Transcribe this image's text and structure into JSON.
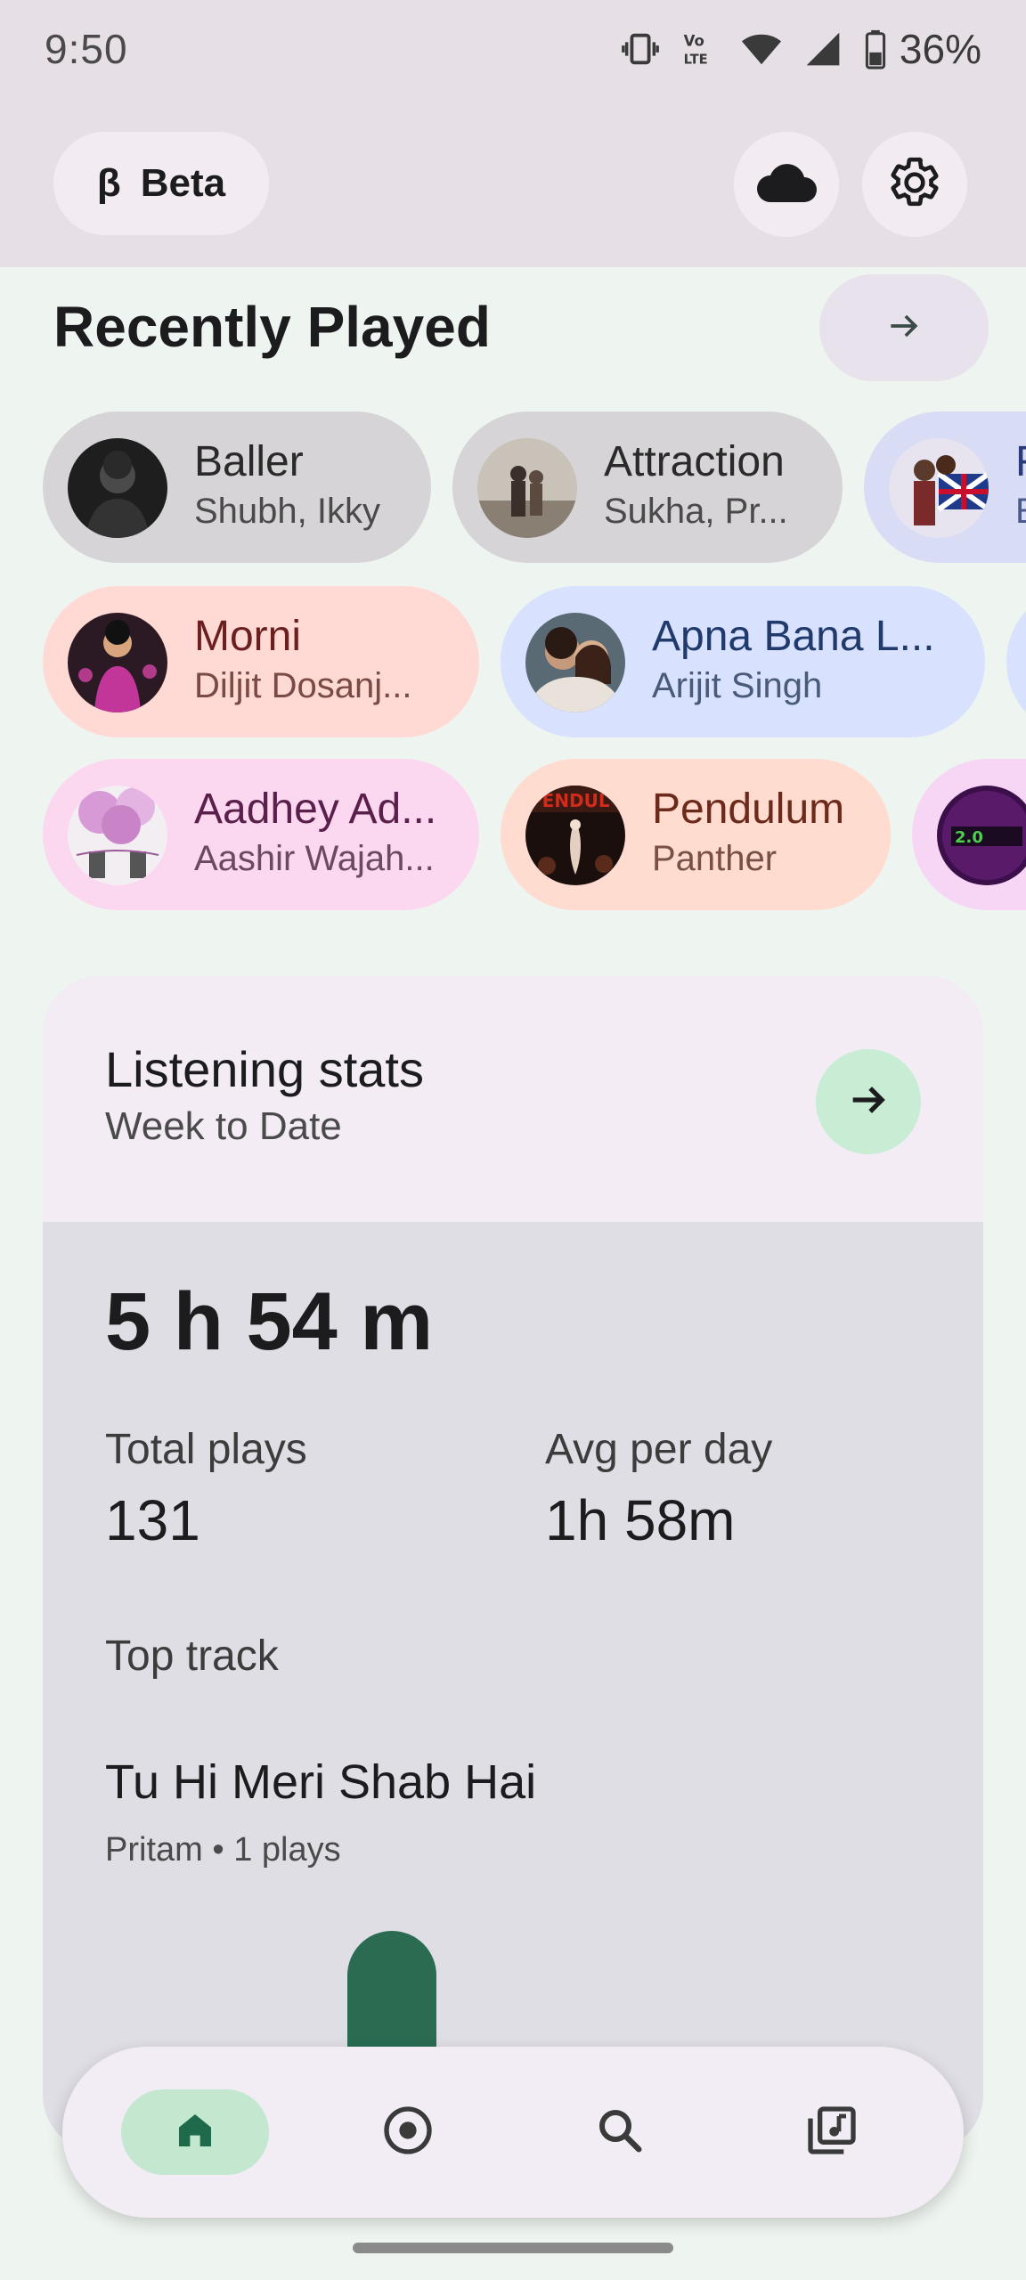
{
  "status_bar": {
    "time": "9:50",
    "battery_percent": "36%",
    "icons": [
      "vibrate-icon",
      "volte-icon",
      "wifi-icon",
      "signal-icon",
      "battery-icon"
    ]
  },
  "app_bar": {
    "beta_symbol": "β",
    "beta_label": "Beta",
    "cloud_icon": "cloud-icon",
    "settings_icon": "gear-icon"
  },
  "recently_played": {
    "title": "Recently Played",
    "rows": [
      [
        {
          "song": "Baller",
          "artist": "Shubh, Ikky",
          "bg": "#d6d4d6",
          "text_color": "#2a2a2a",
          "sub_color": "#4a4a4a"
        },
        {
          "song": "Attraction",
          "artist": "Sukha, Pr...",
          "bg": "#d6d4d6",
          "text_color": "#2a2a2a",
          "sub_color": "#4a4a4a"
        },
        {
          "song": "F",
          "artist": "E",
          "bg": "#d9dcf5",
          "text_color": "#2b3b7a",
          "sub_color": "#4a5a8a"
        }
      ],
      [
        {
          "song": "Morni",
          "artist": "Diljit Dosanj...",
          "bg": "#ffdad5",
          "text_color": "#6b1f1f",
          "sub_color": "#7a4a44"
        },
        {
          "song": "Apna Bana L...",
          "artist": "Arijit Singh",
          "bg": "#d8e2ff",
          "text_color": "#1f3a6b",
          "sub_color": "#4a5a7a"
        }
      ],
      [
        {
          "song": "Aadhey Ad...",
          "artist": "Aashir Wajah...",
          "bg": "#fbd7f0",
          "text_color": "#5a1f4a",
          "sub_color": "#6a4a5e"
        },
        {
          "song": "Pendulum",
          "artist": "Panther",
          "bg": "#ffdbd0",
          "text_color": "#6b2a1a",
          "sub_color": "#7a5044"
        },
        {
          "song": "",
          "artist": "",
          "bg": "#f7d6f5",
          "text_color": "#5a1f5a",
          "sub_color": "#6a4a6a"
        }
      ]
    ]
  },
  "stats": {
    "title": "Listening stats",
    "subtitle": "Week to Date",
    "total_time": "5 h 54 m",
    "total_plays_label": "Total plays",
    "total_plays": "131",
    "avg_label": "Avg per day",
    "avg_value": "1h 58m",
    "top_track_label": "Top track",
    "top_track": "Tu Hi Meri Shab Hai",
    "top_track_meta": "Pritam • 1 plays",
    "daily_levels": [
      0.0,
      0.0,
      1.0,
      0.0,
      0.0,
      0.0,
      0.0
    ],
    "bar_color": "#2a6b52"
  },
  "bottom_nav": {
    "items": [
      "home-icon",
      "radio-icon",
      "search-icon",
      "library-icon"
    ],
    "active": "home-icon",
    "active_bg": "#c4e8cf"
  }
}
